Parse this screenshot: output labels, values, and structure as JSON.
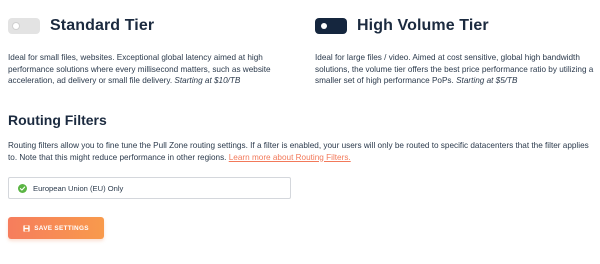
{
  "tiers": {
    "standard": {
      "title": "Standard Tier",
      "enabled": false,
      "description": "Ideal for small files, websites. Exceptional global latency aimed at high performance solutions where every millisecond matters, such as website acceleration, ad delivery or small file delivery.",
      "price": "Starting at $10/TB"
    },
    "volume": {
      "title": "High Volume Tier",
      "enabled": true,
      "description": "Ideal for large files / video. Aimed at cost sensitive, global high bandwidth solutions, the volume tier offers the best price performance ratio by utilizing a smaller set of high performance PoPs.",
      "price": "Starting at $5/TB"
    }
  },
  "routing": {
    "title": "Routing Filters",
    "description": "Routing filters allow you to fine tune the Pull Zone routing settings. If a filter is enabled, your users will only be routed to specific datacenters that the filter applies to. Note that this might reduce performance in other regions.",
    "learn_more": "Learn more about Routing Filters.",
    "filters": [
      {
        "label": "European Union (EU) Only",
        "checked": true
      }
    ]
  },
  "actions": {
    "save_label": "SAVE SETTINGS"
  },
  "colors": {
    "accent": "#f67d5d",
    "accent_end": "#f89a4c",
    "toggle_on": "#15263e",
    "toggle_off": "#e3e3e3",
    "check": "#5bb544",
    "heading": "#1b2a3f"
  }
}
